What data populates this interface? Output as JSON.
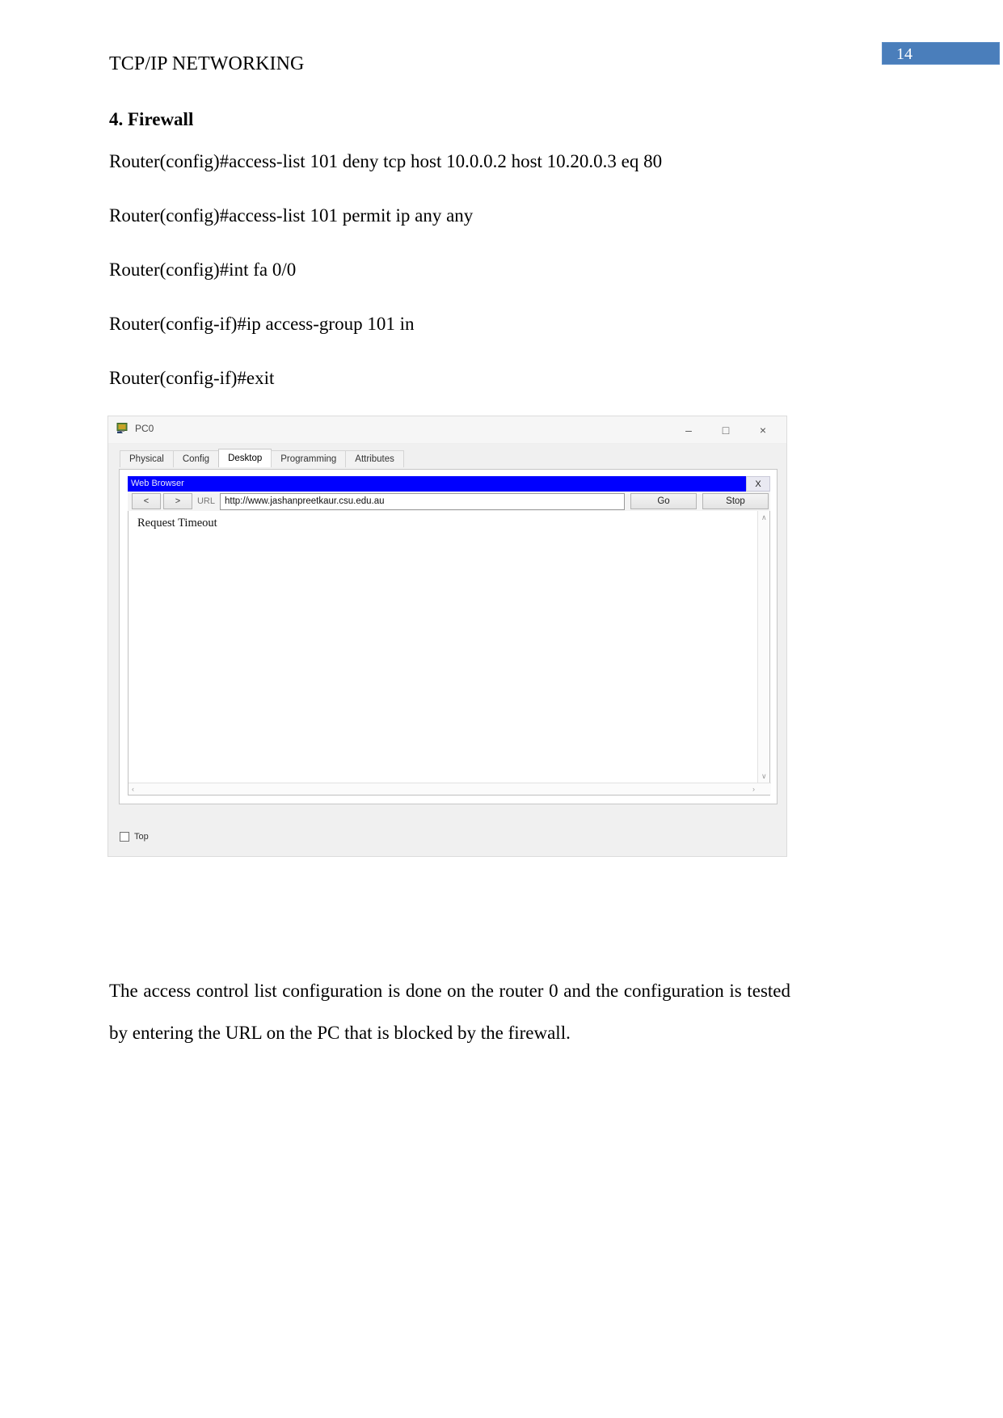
{
  "header": {
    "document_title": "TCP/IP NETWORKING",
    "page_number": "14",
    "badge_color": "#4a7ebb"
  },
  "section": {
    "heading": "4. Firewall",
    "config_lines": [
      "Router(config)#access-list 101 deny tcp host 10.0.0.2 host 10.20.0.3 eq 80",
      "Router(config)#access-list 101 permit ip any any",
      "Router(config)#int fa 0/0",
      "Router(config-if)#ip access-group 101 in",
      "Router(config-if)#exit"
    ]
  },
  "packet_tracer_window": {
    "title": "PC0",
    "window_controls": {
      "minimize": "–",
      "maximize": "□",
      "close": "×"
    },
    "tabs": [
      {
        "label": "Physical",
        "active": false
      },
      {
        "label": "Config",
        "active": false
      },
      {
        "label": "Desktop",
        "active": true
      },
      {
        "label": "Programming",
        "active": false
      },
      {
        "label": "Attributes",
        "active": false
      }
    ],
    "web_browser": {
      "title": "Web Browser",
      "close_label": "X",
      "back_label": "<",
      "forward_label": ">",
      "url_label": "URL",
      "url_value": "http://www.jashanpreetkaur.csu.edu.au",
      "go_label": "Go",
      "stop_label": "Stop",
      "page_content": "Request Timeout",
      "scroll_up": "∧",
      "scroll_down": "∨",
      "scroll_left": "‹",
      "scroll_right": "›"
    },
    "footer": {
      "top_checkbox_label": "Top",
      "top_checked": false
    }
  },
  "closing": {
    "paragraph": "The access control list configuration is done on the router 0 and the configuration is tested by entering the URL on the PC that is blocked by the firewall."
  }
}
